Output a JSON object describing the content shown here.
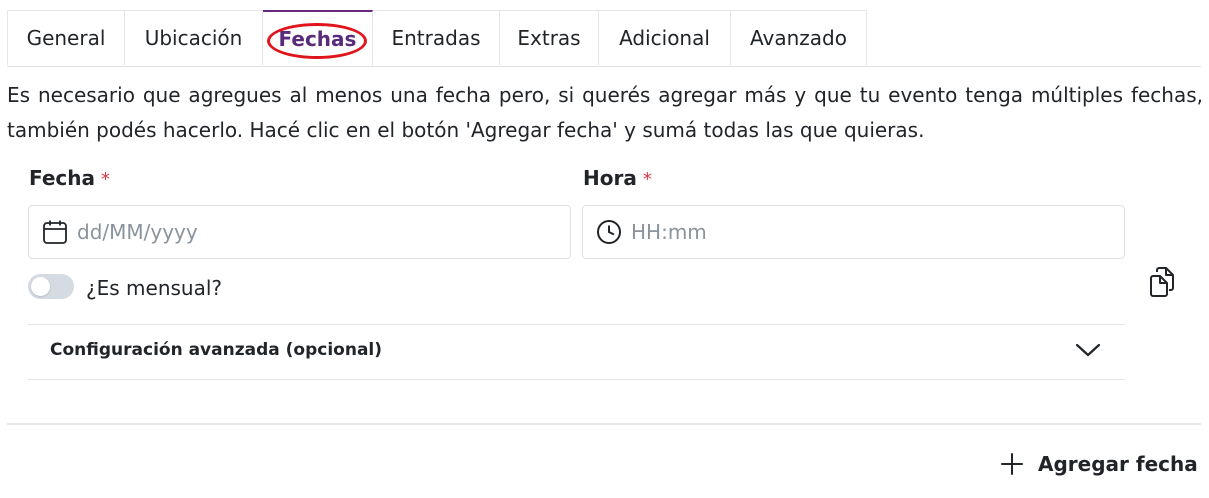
{
  "tabs": [
    {
      "label": "General"
    },
    {
      "label": "Ubicación"
    },
    {
      "label": "Fechas"
    },
    {
      "label": "Entradas"
    },
    {
      "label": "Extras"
    },
    {
      "label": "Adicional"
    },
    {
      "label": "Avanzado"
    }
  ],
  "active_tab": "Fechas",
  "description": "Es necesario que agregues al menos una fecha pero, si querés agregar más y que tu evento tenga múltiples fechas, también podés hacerlo. Hacé clic en el botón 'Agregar fecha' y sumá todas las que quieras.",
  "fecha_field": {
    "label": "Fecha",
    "required_mark": "*",
    "placeholder": "dd/MM/yyyy",
    "value": "",
    "icon": "calendar-icon"
  },
  "hora_field": {
    "label": "Hora",
    "required_mark": "*",
    "placeholder": "HH:mm",
    "value": "",
    "icon": "clock-icon"
  },
  "monthly_toggle": {
    "label": "¿Es mensual?",
    "checked": false
  },
  "advanced_config": {
    "label": "Configuración avanzada (opcional)",
    "expanded": false
  },
  "add_date_button": {
    "label": "Agregar fecha",
    "icon": "plus-icon"
  },
  "colors": {
    "active_tab_text": "#5a2b7a",
    "active_tab_border": "#6a2a80",
    "highlight_ellipse": "#e0141b",
    "required_asterisk": "#dc3545"
  }
}
